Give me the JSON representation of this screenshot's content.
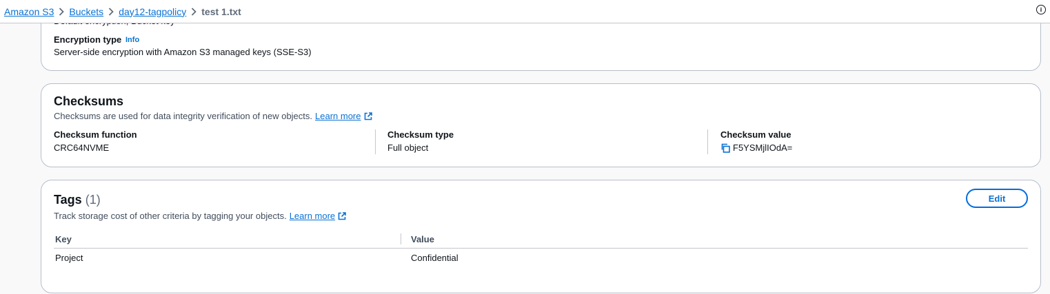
{
  "breadcrumb": {
    "items": [
      "Amazon S3",
      "Buckets",
      "day12-tagpolicy"
    ],
    "current": "test 1.txt"
  },
  "encryption": {
    "clipped_text": "Default encryption, Bucket key",
    "type_label": "Encryption type",
    "info_label": "Info",
    "type_value": "Server-side encryption with Amazon S3 managed keys (SSE-S3)"
  },
  "checksums": {
    "title": "Checksums",
    "description": "Checksums are used for data integrity verification of new objects.",
    "learn_more": "Learn more",
    "function_label": "Checksum function",
    "function_value": "CRC64NVME",
    "type_label": "Checksum type",
    "type_value": "Full object",
    "value_label": "Checksum value",
    "value_value": "F5YSMjlIOdA="
  },
  "tags": {
    "title": "Tags",
    "count": "(1)",
    "description": "Track storage cost of other criteria by tagging your objects.",
    "learn_more": "Learn more",
    "edit_label": "Edit",
    "columns": [
      "Key",
      "Value"
    ],
    "rows": [
      {
        "key": "Project",
        "value": "Confidential"
      }
    ]
  },
  "colors": {
    "link": "#0972d3",
    "border": "#b6bec9",
    "text": "#0f141a"
  }
}
